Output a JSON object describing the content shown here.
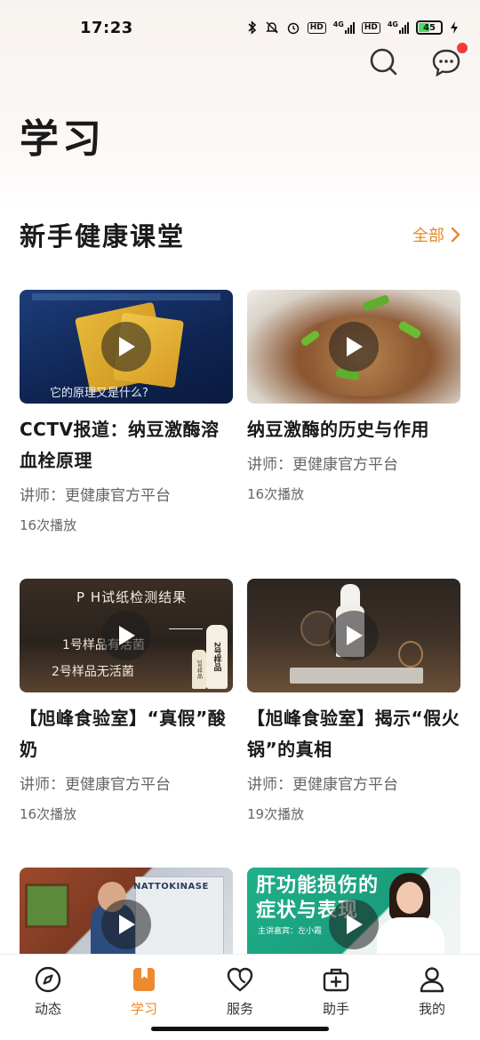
{
  "status_bar": {
    "time": "17:23",
    "hd1": "HD",
    "net1": "4G",
    "hd2": "HD",
    "net2": "4G",
    "battery": "45"
  },
  "header": {
    "title": "学习",
    "icons": [
      "search-icon",
      "message-icon"
    ]
  },
  "section": {
    "title": "新手健康课堂",
    "more_label": "全部"
  },
  "courses": [
    {
      "title": "CCTV报道：纳豆激酶溶血栓原理",
      "lecturer": "讲师：更健康官方平台",
      "plays": "16次播放",
      "thumb_caption": "它的原理又是什么?"
    },
    {
      "title": "纳豆激酶的历史与作用",
      "lecturer": "讲师：更健康官方平台",
      "plays": "16次播放"
    },
    {
      "title": "【旭峰食验室】“真假”酸奶",
      "lecturer": "讲师：更健康官方平台",
      "plays": "16次播放",
      "thumb_caption": "P H试纸检测结果",
      "thumb_line1": "1号样品有活菌",
      "thumb_line2": "2号样品无活菌",
      "thumb_bottle1": "1号样品",
      "thumb_bottle2": "2号样品"
    },
    {
      "title": "【旭峰食验室】揭示“假火锅”的真相",
      "lecturer": "讲师：更健康官方平台",
      "plays": "19次播放"
    },
    {
      "title": "",
      "lecturer": "",
      "plays": "",
      "thumb_caption": "NATTOKINASE"
    },
    {
      "title": "",
      "lecturer": "",
      "plays": "",
      "thumb_caption": "肝功能损伤的",
      "thumb_caption2": "症状与表现",
      "thumb_host": "主讲嘉宾：左小霞"
    }
  ],
  "nav": [
    {
      "label": "动态",
      "icon": "compass-icon",
      "active": false
    },
    {
      "label": "学习",
      "icon": "bookmark-icon",
      "active": true
    },
    {
      "label": "服务",
      "icon": "heart-icon",
      "active": false
    },
    {
      "label": "助手",
      "icon": "medkit-icon",
      "active": false
    },
    {
      "label": "我的",
      "icon": "user-icon",
      "active": false
    }
  ],
  "colors": {
    "accent": "#ee8a2e",
    "more_link": "#e5892b",
    "badge": "#f43b3b"
  }
}
